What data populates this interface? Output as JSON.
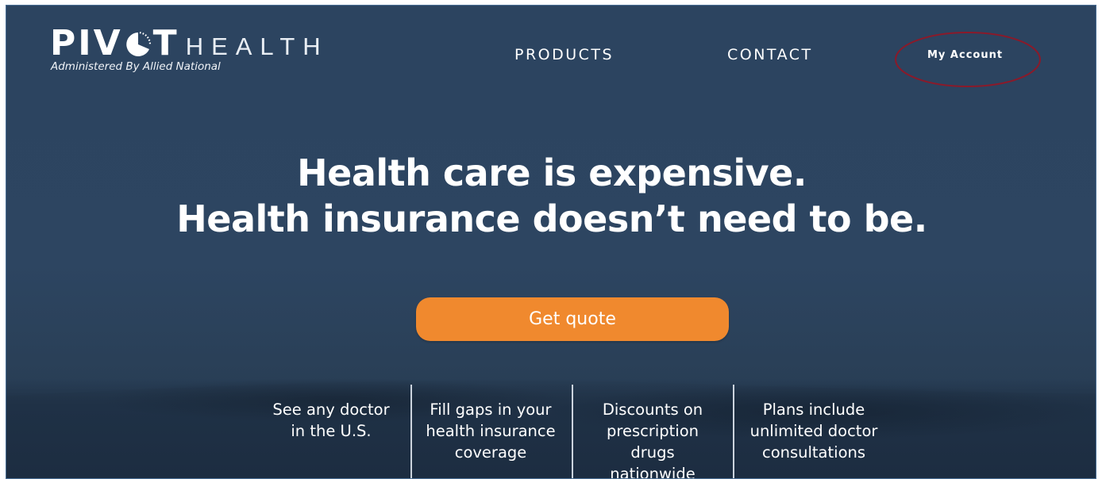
{
  "logo": {
    "pivot": "PIV",
    "pivot_end": "T",
    "health": "HEALTH",
    "subtitle": "Administered By Allied National"
  },
  "nav": {
    "products": "PRODUCTS",
    "contact": "CONTACT",
    "account": "My Account"
  },
  "hero": {
    "line1": "Health care is expensive.",
    "line2": "Health insurance doesn’t need to be.",
    "cta": "Get quote"
  },
  "features": [
    {
      "line1": "See any doctor",
      "line2": "in the U.S."
    },
    {
      "line1": "Fill gaps in your",
      "line2": "health insurance",
      "line3": "coverage"
    },
    {
      "line1": "Discounts on",
      "line2": "prescription",
      "line3": "drugs",
      "line4": "nationwide"
    },
    {
      "line1": "Plans include",
      "line2": "unlimited doctor",
      "line3": "consultations"
    }
  ],
  "colors": {
    "background": "#2c4460",
    "cta": "#f0892e",
    "annotation": "#8a1a2a"
  },
  "icons": {
    "logo_o": "o-pie-icon"
  }
}
